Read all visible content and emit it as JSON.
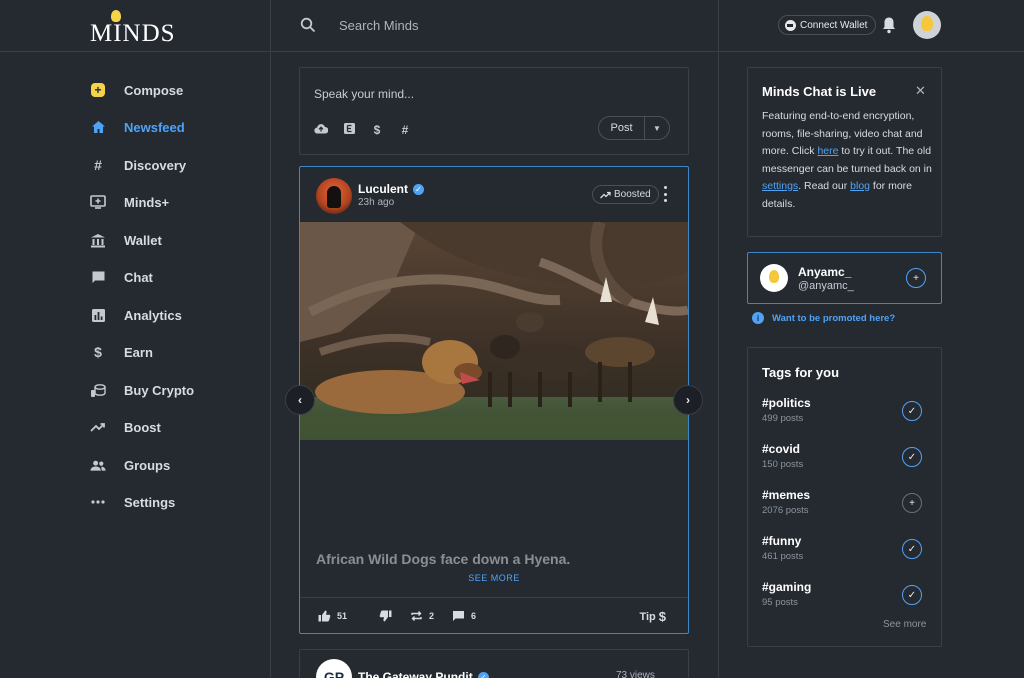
{
  "header": {
    "logo_text": "MINDS",
    "search_placeholder": "Search Minds",
    "connect_wallet": "Connect Wallet"
  },
  "sidebar": {
    "items": [
      {
        "label": "Compose",
        "icon": "compose-icon"
      },
      {
        "label": "Newsfeed",
        "icon": "home-icon",
        "active": true
      },
      {
        "label": "Discovery",
        "icon": "hash-icon"
      },
      {
        "label": "Minds+",
        "icon": "tv-plus-icon"
      },
      {
        "label": "Wallet",
        "icon": "bank-icon"
      },
      {
        "label": "Chat",
        "icon": "chat-bubble-icon"
      },
      {
        "label": "Analytics",
        "icon": "bar-chart-icon"
      },
      {
        "label": "Earn",
        "icon": "dollar-icon"
      },
      {
        "label": "Buy Crypto",
        "icon": "coins-icon"
      },
      {
        "label": "Boost",
        "icon": "trending-up-icon"
      },
      {
        "label": "Groups",
        "icon": "people-icon"
      },
      {
        "label": "Settings",
        "icon": "more-horiz-icon"
      }
    ]
  },
  "composer": {
    "placeholder": "Speak your mind...",
    "post_label": "Post"
  },
  "post": {
    "author": "Luculent",
    "time_ago": "23h ago",
    "boosted_label": "Boosted",
    "caption": "African Wild Dogs face down a Hyena.",
    "see_more": "SEE MORE",
    "likes": "51",
    "reminds": "2",
    "comments": "6",
    "tip_label": "Tip"
  },
  "next_post": {
    "author": "The Gateway Pundit",
    "avatar_initials": "GP",
    "views": "73 views"
  },
  "chat_card": {
    "title": "Minds Chat is Live",
    "text_1": "Featuring end-to-end encryption, rooms, file-sharing, video chat and more. Click ",
    "link_here": "here",
    "text_2": " to try it out. The old messenger can be turned back on in ",
    "link_settings": "settings",
    "text_3": ". Read our ",
    "link_blog": "blog",
    "text_4": " for more details."
  },
  "suggestion": {
    "name": "Anyamc_",
    "handle": "@anyamc_"
  },
  "promo_text": "Want to be promoted here?",
  "tags": {
    "title": "Tags for you",
    "items": [
      {
        "name": "#politics",
        "count": "499 posts",
        "selected": true
      },
      {
        "name": "#covid",
        "count": "150 posts",
        "selected": true
      },
      {
        "name": "#memes",
        "count": "2076 posts",
        "selected": false
      },
      {
        "name": "#funny",
        "count": "461 posts",
        "selected": true
      },
      {
        "name": "#gaming",
        "count": "95 posts",
        "selected": true
      }
    ],
    "see_more": "See more"
  },
  "colors": {
    "background": "#252a31",
    "accent": "#4fa3f5",
    "border": "#3a3f47"
  }
}
